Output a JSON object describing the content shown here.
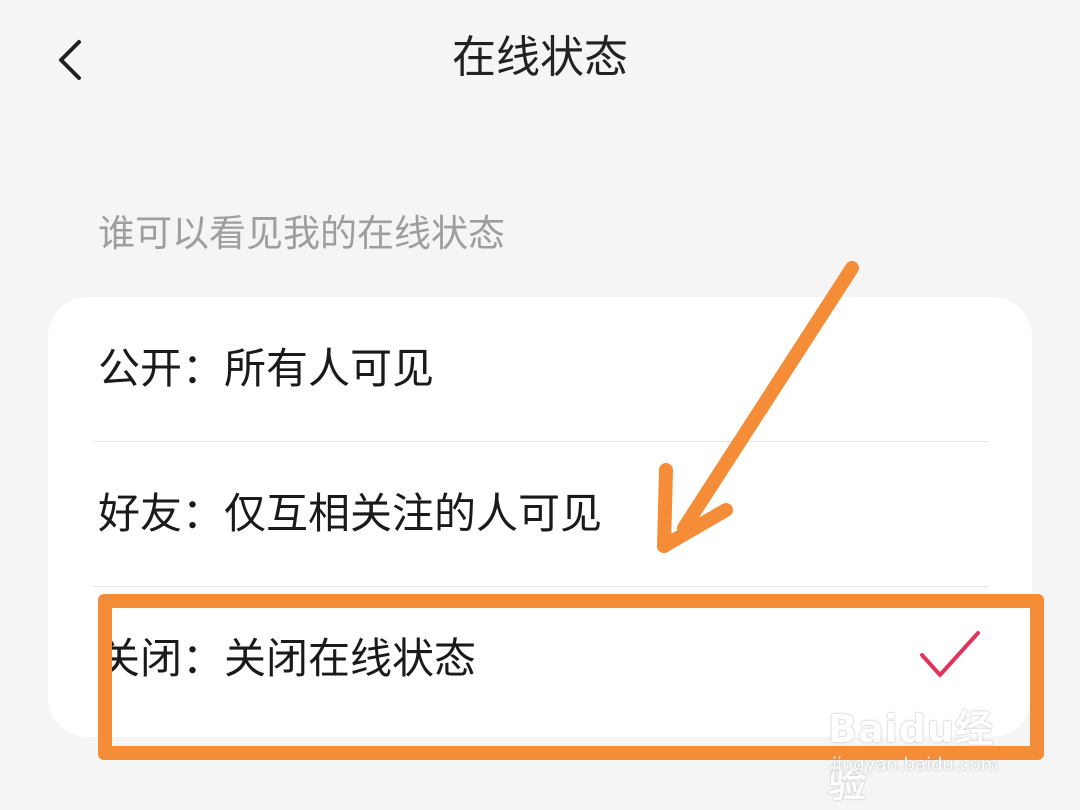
{
  "header": {
    "title": "在线状态"
  },
  "section": {
    "label": "谁可以看见我的在线状态"
  },
  "options": [
    {
      "label": "公开：所有人可见",
      "selected": false
    },
    {
      "label": "好友：仅互相关注的人可见",
      "selected": false
    },
    {
      "label": "关闭：关闭在线状态",
      "selected": true
    }
  ],
  "icons": {
    "back": "chevron-left-icon",
    "selected": "checkmark-icon"
  },
  "colors": {
    "annotation": "#f58c37",
    "check": "#e2335b",
    "label_gray": "#9e9e9e",
    "background": "#f5f5f5"
  },
  "watermark": {
    "brand": "Baidu经验",
    "url": "jingyan.baidu.com"
  }
}
